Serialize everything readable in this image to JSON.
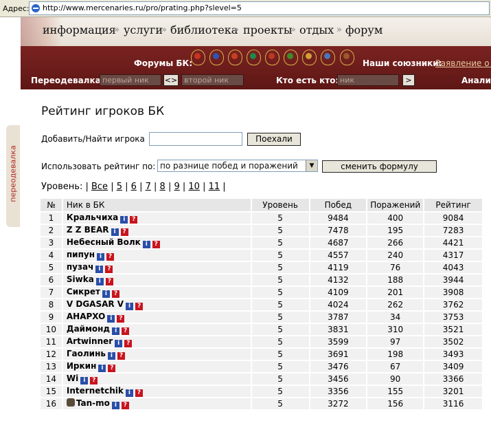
{
  "browser": {
    "address_label": "Адрес:",
    "url": "http://www.mercenaries.ru/pro/prating.php?slevel=5"
  },
  "nav": [
    {
      "label": "информация"
    },
    {
      "label": "услуги"
    },
    {
      "label": "библиотека"
    },
    {
      "label": "проекты"
    },
    {
      "label": "отдых"
    },
    {
      "label": "форум"
    }
  ],
  "nav_separator": "»",
  "forums": {
    "label": "Форумы БК:",
    "emblems": [
      {
        "icon": "clan-emblem-icon",
        "color": "#c9341f"
      },
      {
        "icon": "clan-emblem-icon",
        "color": "#2f55b3"
      },
      {
        "icon": "clan-emblem-icon",
        "color": "#c8401f"
      },
      {
        "icon": "clan-emblem-icon",
        "color": "#1f8a4a"
      },
      {
        "icon": "clan-emblem-icon",
        "color": "#b83a24"
      },
      {
        "icon": "clan-emblem-icon",
        "color": "#3f8a2a"
      },
      {
        "icon": "clan-emblem-icon",
        "color": "#d0a034"
      },
      {
        "icon": "clan-emblem-icon",
        "color": "#4a76b8"
      },
      {
        "icon": "clan-emblem-icon",
        "color": "#9a5a2a"
      }
    ]
  },
  "allies": {
    "label": "Наши союзники:",
    "link": "Заявление о с"
  },
  "dressup": {
    "label": "Переодевалка:",
    "placeholder1": "первый ник",
    "swap": "<>",
    "placeholder2": "второй ник"
  },
  "whois": {
    "label": "Кто есть кто:",
    "placeholder": "ник",
    "go": ">",
    "analysis": "Анализ"
  },
  "side_tab": "переодевалка",
  "page": {
    "title": "Рейтинг игроков БК",
    "add_label": "Добавить/Найти игрока",
    "go_button": "Поехали",
    "use_label": "Использовать рейтинг по:",
    "formula_select": "по разнице побед и поражений",
    "change_button": "сменить формулу",
    "levels_label": "Уровень:",
    "levels": [
      "Все",
      "5",
      "6",
      "7",
      "8",
      "9",
      "10",
      "11"
    ]
  },
  "table": {
    "headers": [
      "№",
      "Ник в БК",
      "Уровень",
      "Побед",
      "Поражений",
      "Рейтинг"
    ],
    "rows": [
      {
        "n": "1",
        "nick": "Кральчиха",
        "lvl": "5",
        "win": "9484",
        "loss": "400",
        "rating": "9084"
      },
      {
        "n": "2",
        "nick": "Z Z BEAR",
        "lvl": "5",
        "win": "7478",
        "loss": "195",
        "rating": "7283"
      },
      {
        "n": "3",
        "nick": "Небесный Волк",
        "lvl": "5",
        "win": "4687",
        "loss": "266",
        "rating": "4421"
      },
      {
        "n": "4",
        "nick": "пипун",
        "lvl": "5",
        "win": "4557",
        "loss": "240",
        "rating": "4317"
      },
      {
        "n": "5",
        "nick": "пузач",
        "lvl": "5",
        "win": "4119",
        "loss": "76",
        "rating": "4043"
      },
      {
        "n": "6",
        "nick": "Siwka",
        "lvl": "5",
        "win": "4132",
        "loss": "188",
        "rating": "3944"
      },
      {
        "n": "7",
        "nick": "Сикрет",
        "lvl": "5",
        "win": "4109",
        "loss": "201",
        "rating": "3908"
      },
      {
        "n": "8",
        "nick": "V DGASAR V",
        "lvl": "5",
        "win": "4024",
        "loss": "262",
        "rating": "3762"
      },
      {
        "n": "9",
        "nick": "AHAPXO",
        "lvl": "5",
        "win": "3787",
        "loss": "34",
        "rating": "3753"
      },
      {
        "n": "10",
        "nick": "Даймонд",
        "lvl": "5",
        "win": "3831",
        "loss": "310",
        "rating": "3521"
      },
      {
        "n": "11",
        "nick": "Artwinner",
        "lvl": "5",
        "win": "3599",
        "loss": "97",
        "rating": "3502"
      },
      {
        "n": "12",
        "nick": "Гаолинь",
        "lvl": "5",
        "win": "3691",
        "loss": "198",
        "rating": "3493"
      },
      {
        "n": "13",
        "nick": "Иркин",
        "lvl": "5",
        "win": "3476",
        "loss": "67",
        "rating": "3409"
      },
      {
        "n": "14",
        "nick": "Wi",
        "lvl": "5",
        "win": "3456",
        "loss": "90",
        "rating": "3366"
      },
      {
        "n": "15",
        "nick": "Internetchik",
        "lvl": "5",
        "win": "3356",
        "loss": "155",
        "rating": "3201"
      },
      {
        "n": "16",
        "nick": "Tan-mo",
        "lvl": "5",
        "win": "3272",
        "loss": "156",
        "rating": "3116"
      }
    ]
  }
}
